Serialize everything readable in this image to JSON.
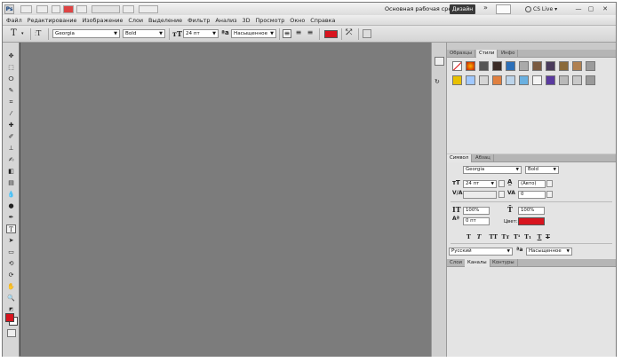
{
  "menubar": {
    "menu_items": [
      "Файл",
      "Редактирование",
      "Изображение",
      "Слои",
      "Выделение",
      "Фильтр",
      "Анализ",
      "3D",
      "Просмотр",
      "Окно",
      "Справка"
    ],
    "workspace_label": "Основная рабочая среда",
    "design_button": "Дизайн",
    "cs_live": "CS Live ▾"
  },
  "options": {
    "tool_glyph": "T",
    "font_family": "Georgia",
    "font_style": "Bold",
    "font_size": "24 пт",
    "antialias": "Насыщенное",
    "text_color": "#d8141e"
  },
  "swatches_panel": {
    "tabs": [
      "Образцы",
      "Стили",
      "Инфо"
    ],
    "active_tab": "Стили"
  },
  "character_panel": {
    "tabs": [
      "Символ",
      "Абзац"
    ],
    "font_family": "Georgia",
    "font_style": "Bold",
    "size": "24 пт",
    "leading": "(Авто)",
    "kerning": "",
    "tracking": "0",
    "vertical_scale": "100%",
    "horizontal_scale": "100%",
    "baseline_shift": "0 пт",
    "color_label": "Цвет:",
    "color": "#d8141e",
    "language": "Русский",
    "antialias": "Насыщенное"
  },
  "layers_panel": {
    "tabs": [
      "Слои",
      "Каналы",
      "Контуры"
    ]
  },
  "colors": {
    "foreground": "#d8141e",
    "background": "#ffffff",
    "canvas": "#7c7c7c"
  }
}
